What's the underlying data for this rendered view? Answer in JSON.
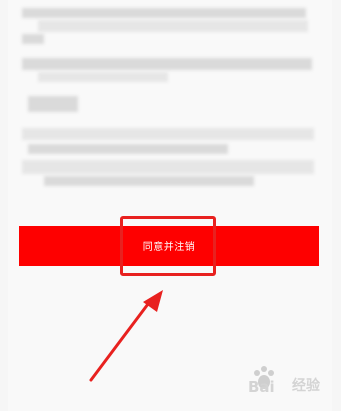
{
  "dialog": {
    "agree_button_label": "同意并注销"
  },
  "annotation": {
    "highlight_color": "#e8211f",
    "arrow_color": "#e8211f"
  },
  "watermark": {
    "logo_text": "Baidu经验",
    "icon": "paw-icon"
  },
  "colors": {
    "button_bg": "#fe0000",
    "button_text": "#ffffff",
    "page_bg": "#f6f6f6"
  }
}
